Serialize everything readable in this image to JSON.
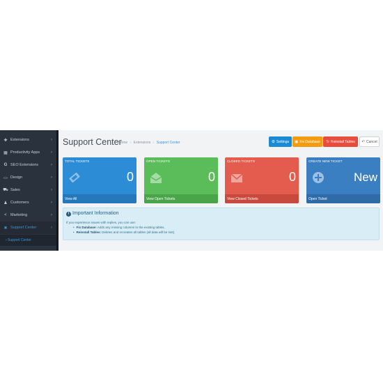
{
  "sidebar": {
    "items": [
      {
        "icon": "puzzle-icon",
        "glyph": "✚",
        "label": "Extensions"
      },
      {
        "icon": "grid-icon",
        "glyph": "▦",
        "label": "Productivity Apps"
      },
      {
        "icon": "google-icon",
        "glyph": "G",
        "label": "SEO Extensions"
      },
      {
        "icon": "monitor-icon",
        "glyph": "▭",
        "label": "Design"
      },
      {
        "icon": "cart-icon",
        "glyph": "⛟",
        "label": "Sales"
      },
      {
        "icon": "user-icon",
        "glyph": "♟",
        "label": "Customers"
      },
      {
        "icon": "share-icon",
        "glyph": "<",
        "label": "Marketing"
      },
      {
        "icon": "support-icon",
        "glyph": "✖",
        "label": "Support Center"
      }
    ],
    "sub_item": "› Support Center",
    "chevron": "›"
  },
  "header": {
    "title": "Support Center",
    "breadcrumb": [
      "Home",
      "Extensions",
      "Support Center"
    ],
    "breadcrumb_sep": "›"
  },
  "toolbar": {
    "settings_icon": "⚙",
    "settings_label": "Settings",
    "fix_icon": "▣",
    "fix_label": "Fix Database",
    "reinstall_icon": "↻",
    "reinstall_label": "Reinstall Tables",
    "cancel_icon": "↶",
    "cancel_label": "Cancel"
  },
  "tiles": {
    "total": {
      "label": "TOTAL TICKETS",
      "value": "0",
      "footer": "View All",
      "icon": "ticket-icon"
    },
    "open": {
      "label": "OPEN TICKETS",
      "value": "0",
      "footer": "View Open Tickets",
      "icon": "envelope-open-icon"
    },
    "closed": {
      "label": "CLOSED TICKETS",
      "value": "0",
      "footer": "View Closed Tickets",
      "icon": "envelope-icon"
    },
    "create": {
      "label": "CREATE NEW TICKET",
      "value": "New",
      "footer": "Open Ticket",
      "icon": "plus-circle-icon"
    }
  },
  "colors": {
    "blue": "#2d8cd6",
    "green": "#5bbd5a",
    "red": "#e35c4d",
    "navy": "#3a7fc1",
    "orange": "#f39c12",
    "sidebar": "#2a323d",
    "info_bg": "#d9edf7"
  },
  "info": {
    "icon": "i",
    "heading": "Important Information",
    "intro": "If you experience issues with replies, you can use:",
    "items": [
      {
        "term": "Fix Database:",
        "desc": " Adds any missing columns to the existing tables."
      },
      {
        "term": "Reinstall Tables:",
        "desc": " Deletes and recreates all tables (all data will be lost)."
      }
    ],
    "bullet": "•"
  }
}
